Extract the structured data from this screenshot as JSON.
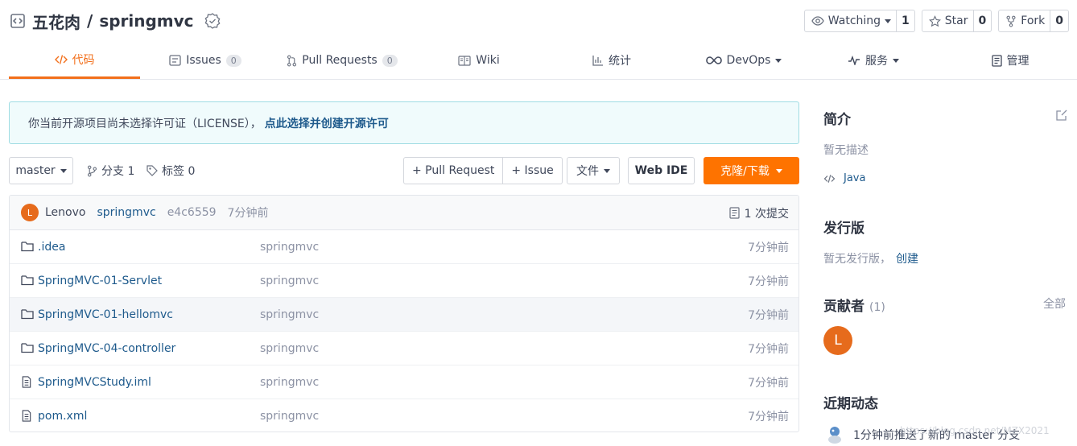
{
  "repo": {
    "owner": "五花肉",
    "sep": "/",
    "name": "springmvc"
  },
  "header_buttons": {
    "watch": {
      "label": "Watching",
      "count": "1"
    },
    "star": {
      "label": "Star",
      "count": "0"
    },
    "fork": {
      "label": "Fork",
      "count": "0"
    }
  },
  "tabs": [
    {
      "label": "代码",
      "icon": "code-icon",
      "active": true
    },
    {
      "label": "Issues",
      "badge": "0",
      "icon": "issues-icon"
    },
    {
      "label": "Pull Requests",
      "badge": "0",
      "icon": "pull-request-icon"
    },
    {
      "label": "Wiki",
      "icon": "wiki-icon"
    },
    {
      "label": "统计",
      "icon": "stats-icon"
    },
    {
      "label": "DevOps",
      "icon": "devops-icon",
      "dropdown": true
    },
    {
      "label": "服务",
      "icon": "service-icon",
      "dropdown": true
    },
    {
      "label": "管理",
      "icon": "manage-icon"
    }
  ],
  "notice": {
    "text": "你当前开源项目尚未选择许可证（LICENSE），",
    "link": "点此选择并创建开源许可"
  },
  "toolbar": {
    "branch": "master",
    "branches": "分支 1",
    "tags": "标签 0",
    "new_pr": "+ Pull Request",
    "new_issue": "+ Issue",
    "file": "文件",
    "web_ide": "Web IDE",
    "clone": "克隆/下载"
  },
  "commit": {
    "avatar_letter": "L",
    "author": "Lenovo",
    "message": "springmvc",
    "sha": "e4c6559",
    "time": "7分钟前",
    "count": "1 次提交"
  },
  "files": [
    {
      "type": "folder",
      "name": ".idea",
      "message": "springmvc",
      "time": "7分钟前"
    },
    {
      "type": "folder",
      "name": "SpringMVC-01-Servlet",
      "message": "springmvc",
      "time": "7分钟前"
    },
    {
      "type": "folder",
      "name": "SpringMVC-01-hellomvc",
      "message": "springmvc",
      "time": "7分钟前"
    },
    {
      "type": "folder",
      "name": "SpringMVC-04-controller",
      "message": "springmvc",
      "time": "7分钟前"
    },
    {
      "type": "file",
      "name": "SpringMVCStudy.iml",
      "message": "springmvc",
      "time": "7分钟前"
    },
    {
      "type": "file",
      "name": "pom.xml",
      "message": "springmvc",
      "time": "7分钟前"
    }
  ],
  "sidebar": {
    "intro_title": "简介",
    "intro_desc": "暂无描述",
    "language": "Java",
    "release_title": "发行版",
    "release_text": "暂无发行版，",
    "release_link": "创建",
    "contributors_title": "贡献者",
    "contributors_count": "(1)",
    "contributors_all": "全部",
    "contributor_letter": "L",
    "activity_title": "近期动态",
    "activity_text": "1分钟前推送了新的 master 分支"
  },
  "watermark": "https://blog.csdn.net/MZX2021",
  "colors": {
    "accent": "#f26f1b",
    "clone_button": "#fe7300",
    "link": "#1e5a8c"
  }
}
